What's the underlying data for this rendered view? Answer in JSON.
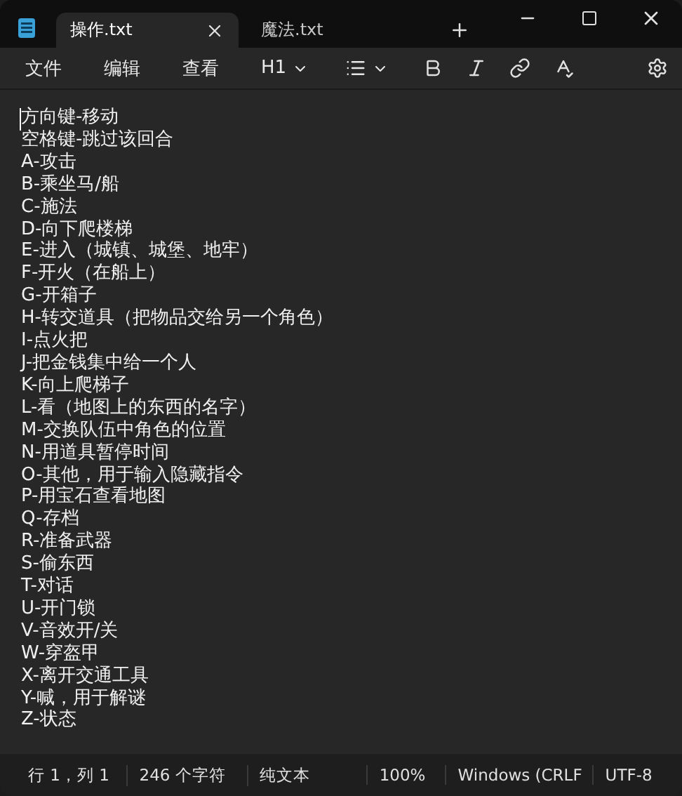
{
  "tabs": [
    {
      "label": "操作.txt",
      "selected": true
    },
    {
      "label": "魔法.txt",
      "selected": false
    }
  ],
  "menu": [
    {
      "kind": "menu",
      "label": "文件"
    },
    {
      "kind": "menu",
      "label": "编辑"
    },
    {
      "kind": "menu",
      "label": "查看"
    },
    {
      "kind": "heading",
      "label": "H1"
    },
    {
      "kind": "list"
    },
    {
      "kind": "bold"
    },
    {
      "kind": "italic"
    },
    {
      "kind": "link"
    },
    {
      "kind": "spellcheck"
    }
  ],
  "lines": [
    "方向键-移动",
    "空格键-跳过该回合",
    "A-攻击",
    "B-乘坐马/船",
    "C-施法",
    "D-向下爬楼梯",
    "E-进入（城镇、城堡、地牢）",
    "F-开火（在船上）",
    "G-开箱子",
    "H-转交道具（把物品交给另一个角色）",
    "I-点火把",
    "J-把金钱集中给一个人",
    "K-向上爬梯子",
    "L-看（地图上的东西的名字）",
    "M-交换队伍中角色的位置",
    "N-用道具暂停时间",
    "O-其他，用于输入隐藏指令",
    "P-用宝石查看地图",
    "Q-存档",
    "R-准备武器",
    "S-偷东西",
    "T-对话",
    "U-开门锁",
    "V-音效开/关",
    "W-穿盔甲",
    "X-离开交通工具",
    "Y-喊，用于解谜",
    "Z-状态"
  ],
  "status_bar": [
    "行 1，列 1",
    "246 个字符",
    "纯文本",
    "100%",
    "Windows (CRLF",
    "UTF-8"
  ]
}
